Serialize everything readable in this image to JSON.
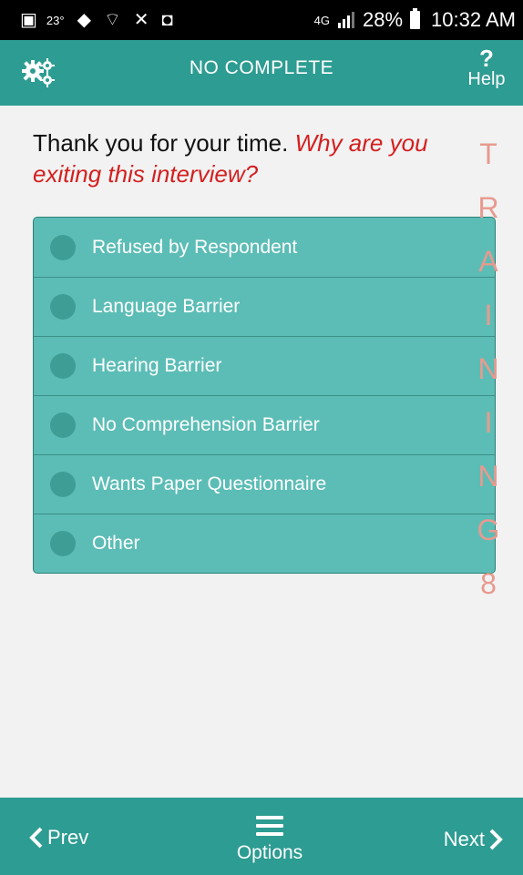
{
  "status_bar": {
    "temperature": "23°",
    "network": "4G",
    "battery": "28%",
    "time": "10:32 AM"
  },
  "header": {
    "title": "NO COMPLETE",
    "help_label": "Help",
    "icons": {
      "left": "gears-icon",
      "right": "question-mark-icon"
    }
  },
  "question": {
    "prefix": "Thank you for your time.",
    "emphasis": "Why are you exiting this interview?"
  },
  "options": [
    {
      "label": "Refused by Respondent",
      "selected": false
    },
    {
      "label": "Language Barrier",
      "selected": false
    },
    {
      "label": "Hearing Barrier",
      "selected": false
    },
    {
      "label": "No Comprehension Barrier",
      "selected": false
    },
    {
      "label": "Wants Paper Questionnaire",
      "selected": false
    },
    {
      "label": "Other",
      "selected": false
    }
  ],
  "watermark": [
    "T",
    "R",
    "A",
    "I",
    "N",
    "I",
    "N",
    "G",
    "8"
  ],
  "footer": {
    "prev_label": "Prev",
    "options_label": "Options",
    "next_label": "Next"
  },
  "colors": {
    "accent": "#2d9c92",
    "option_bg": "#5cbdb6",
    "question_emphasis": "#d41f1f",
    "watermark": "#e79a8f"
  }
}
